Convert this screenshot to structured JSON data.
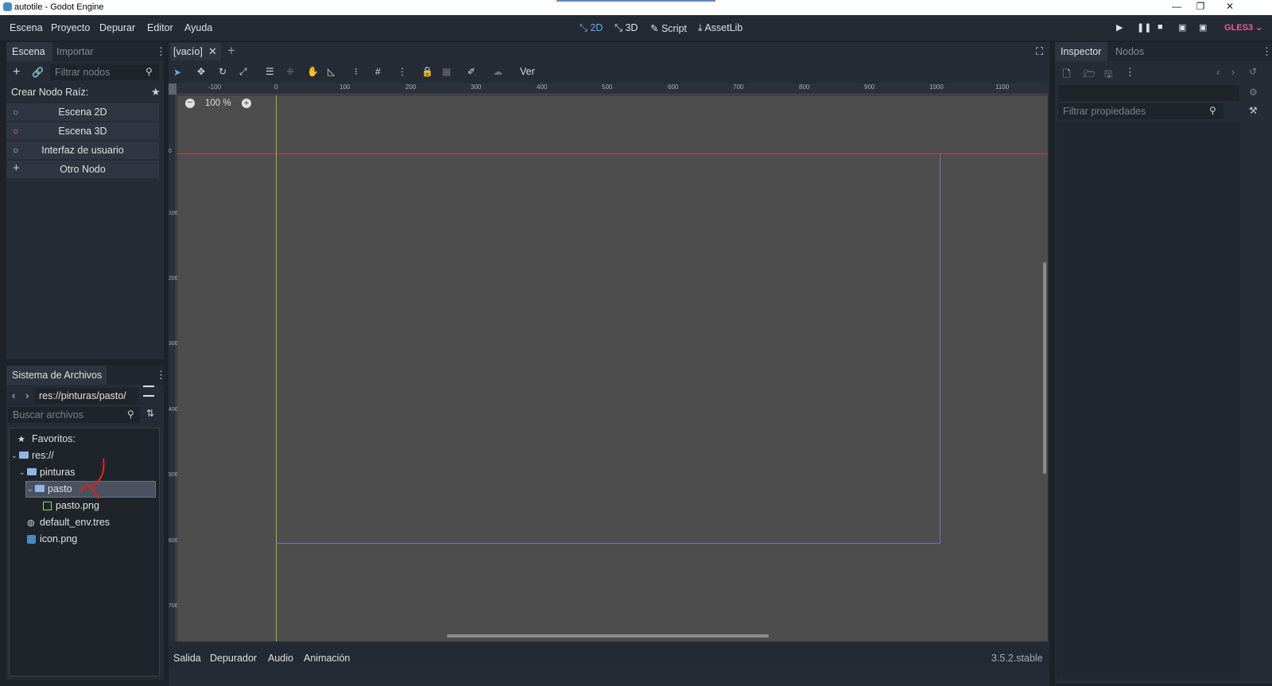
{
  "window": {
    "title": "autotile - Godot Engine",
    "icon": "godot-logo-icon",
    "minimize": "—",
    "maximize": "❐",
    "close": "✕"
  },
  "menu": [
    "Escena",
    "Proyecto",
    "Depurar",
    "Editor",
    "Ayuda"
  ],
  "workspaces": [
    {
      "label": "2D",
      "icon": "2d-icon",
      "active": true
    },
    {
      "label": "3D",
      "icon": "3d-icon",
      "active": false
    },
    {
      "label": "Script",
      "icon": "script-icon",
      "active": false
    },
    {
      "label": "AssetLib",
      "icon": "assetlib-icon",
      "active": false
    }
  ],
  "renderer": "GLES3",
  "scene_dock": {
    "tabs": [
      "Escena",
      "Importar"
    ],
    "filter_placeholder": "Filtrar nodos",
    "create_root_label": "Crear Nodo Raíz:",
    "root_options": [
      {
        "label": "Escena 2D",
        "icon": "node2d-icon",
        "color": "#8da5f3"
      },
      {
        "label": "Escena 3D",
        "icon": "spatial-icon",
        "color": "#fc7f7f"
      },
      {
        "label": "Interfaz de usuario",
        "icon": "control-icon",
        "color": "#8eef97"
      },
      {
        "label": "Otro Nodo",
        "icon": "add-icon",
        "color": "#e0e0e0"
      }
    ]
  },
  "filesystem": {
    "title": "Sistema de Archivos",
    "path": "res://pinturas/pasto/",
    "search_placeholder": "Buscar archivos",
    "items": [
      {
        "label": "Favoritos:",
        "icon": "star-icon"
      },
      {
        "label": "res://",
        "icon": "folder-icon"
      },
      {
        "label": "pinturas",
        "icon": "folder-icon"
      },
      {
        "label": "pasto",
        "icon": "folder-icon",
        "selected": true
      },
      {
        "label": "pasto.png",
        "icon": "image-file-icon"
      },
      {
        "label": "default_env.tres",
        "icon": "environment-icon"
      },
      {
        "label": "icon.png",
        "icon": "image-file-icon"
      }
    ]
  },
  "editor": {
    "scene_tab": "[vacío]",
    "toolbar_view": "Ver",
    "zoom": "100 %",
    "ruler_h": [
      "-100",
      "0",
      "100",
      "200",
      "300",
      "400",
      "500",
      "600",
      "700",
      "800",
      "900",
      "1000",
      "1100"
    ],
    "ruler_v": [
      "0",
      "100",
      "200",
      "300",
      "400",
      "500",
      "600",
      "700"
    ]
  },
  "bottom_panel": {
    "tabs": [
      "Salida",
      "Depurador",
      "Audio",
      "Animación"
    ],
    "version": "3.5.2.stable"
  },
  "inspector": {
    "tabs": [
      "Inspector",
      "Nodos"
    ],
    "filter_placeholder": "Filtrar propiedades"
  },
  "colors": {
    "accent": "#6fa8ee",
    "x_axis": "#d13c3c",
    "y_axis": "#8fbf3c",
    "viewport_rect": "#7c6fc7",
    "canvas": "#4d4d4d",
    "annotation": "#e02020",
    "renderer": "#e85b9a"
  }
}
